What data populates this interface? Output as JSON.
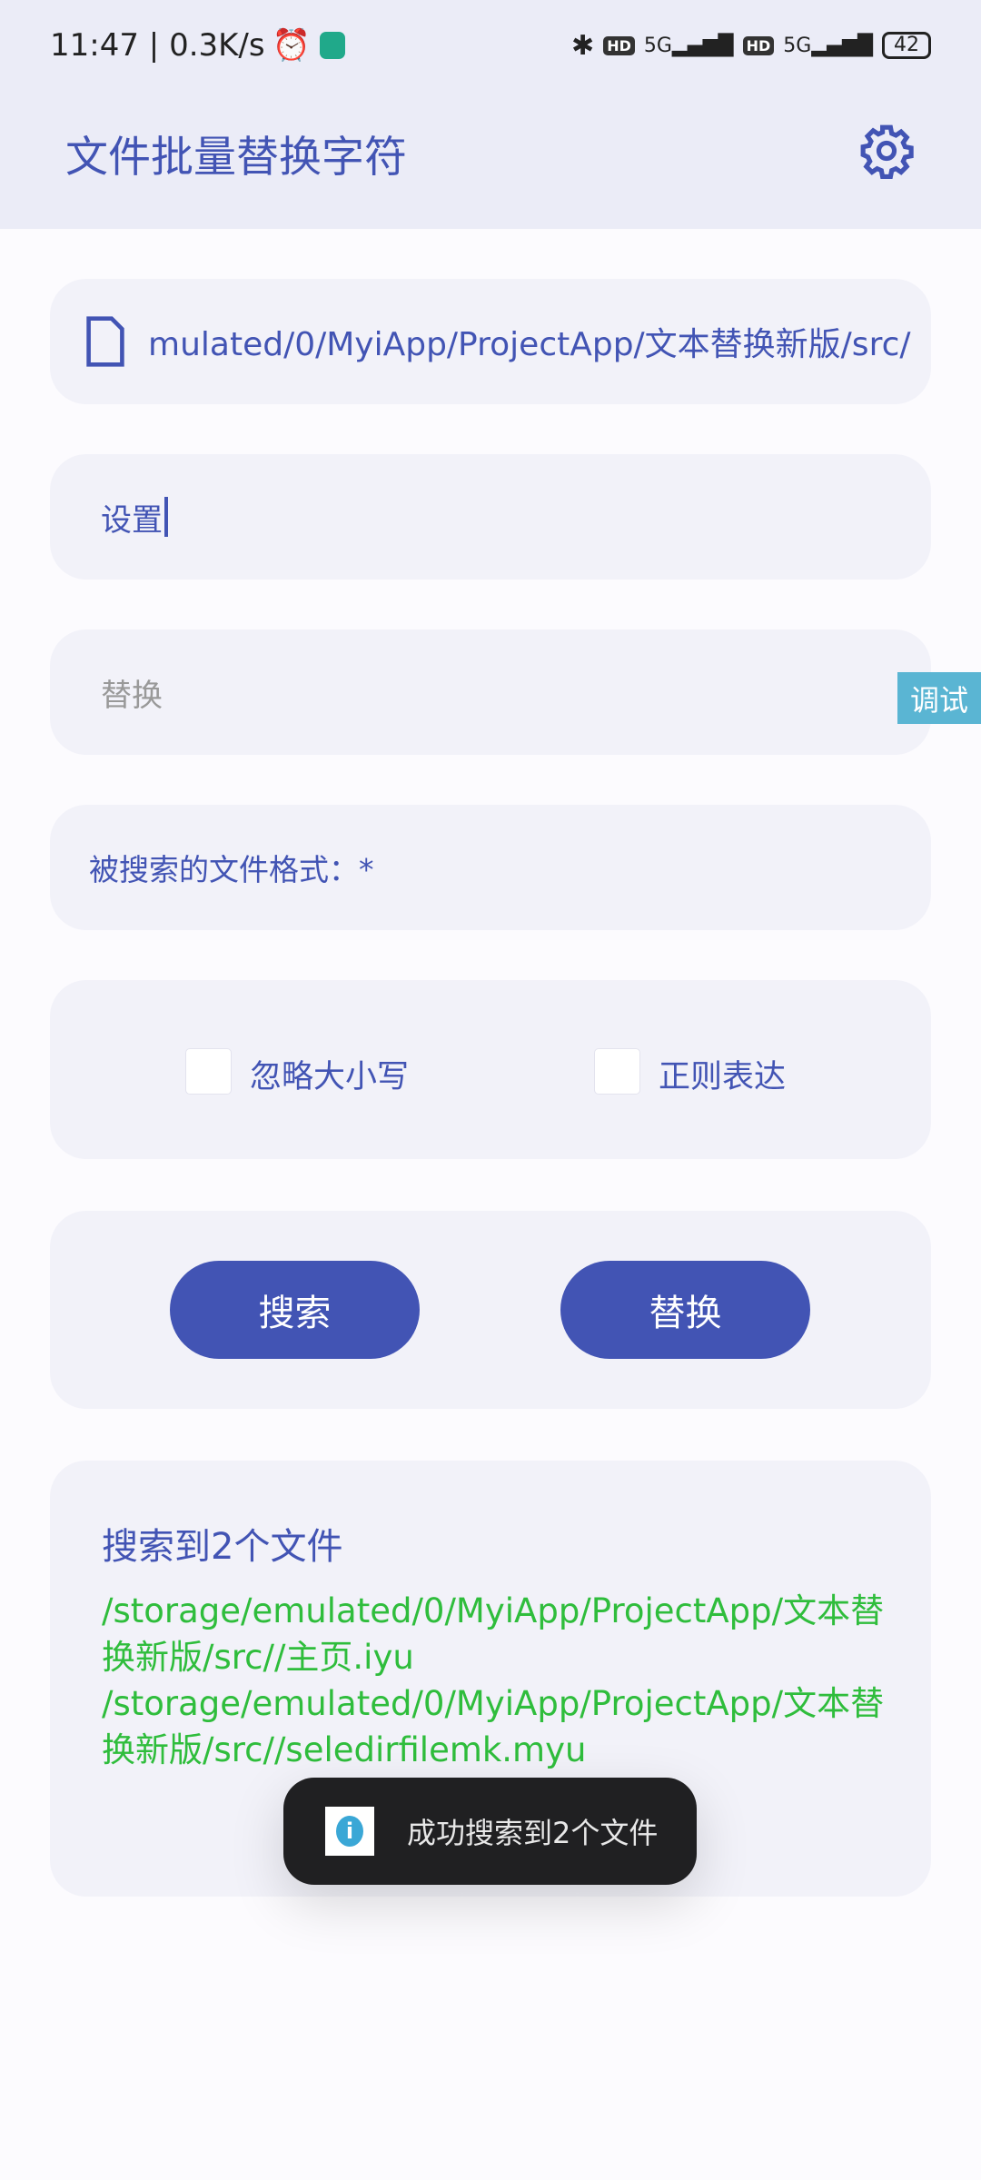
{
  "status_bar": {
    "time": "11:47",
    "net_speed": "0.3K/s",
    "battery": "42",
    "network": "5G",
    "hd": "HD"
  },
  "header": {
    "title": "文件批量替换字符",
    "settings_icon": "gear-icon"
  },
  "folder_path": "mulated/0/MyiApp/ProjectApp/文本替换新版/src/",
  "search_field": {
    "value": "设置"
  },
  "replace_field": {
    "placeholder": "替换"
  },
  "file_format": "被搜索的文件格式：*",
  "options": {
    "ignore_case": {
      "label": "忽略大小写",
      "checked": false
    },
    "regex": {
      "label": "正则表达",
      "checked": false
    }
  },
  "buttons": {
    "search": "搜索",
    "replace": "替换"
  },
  "debug_tag": "调试",
  "results": {
    "title": "搜索到2个文件",
    "files": [
      "/storage/emulated/0/MyiApp/ProjectApp/文本替换新版/src//主页.iyu",
      "/storage/emulated/0/MyiApp/ProjectApp/文本替换新版/src//seledirfilemk.myu"
    ]
  },
  "toast": {
    "message": "成功搜索到2个文件"
  },
  "colors": {
    "accent": "#4254b4",
    "result_green": "#2fbd3c",
    "header_bg": "#ebecf7"
  }
}
